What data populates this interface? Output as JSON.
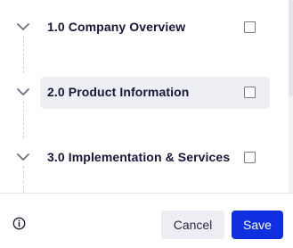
{
  "sections": [
    {
      "label": "1.0 Company Overview",
      "checked": false,
      "active": false,
      "icon": "chevron-down-icon"
    },
    {
      "label": "2.0 Product Information",
      "checked": false,
      "active": true,
      "icon": "chevron-down-icon"
    },
    {
      "label": "3.0 Implementation & Services",
      "checked": false,
      "active": false,
      "icon": "chevron-down-icon"
    }
  ],
  "footer": {
    "info_icon": "info-icon",
    "cancel_label": "Cancel",
    "save_label": "Save"
  },
  "colors": {
    "accent": "#0f2fe0",
    "active_row": "#eeeef5",
    "text": "#16173a"
  }
}
